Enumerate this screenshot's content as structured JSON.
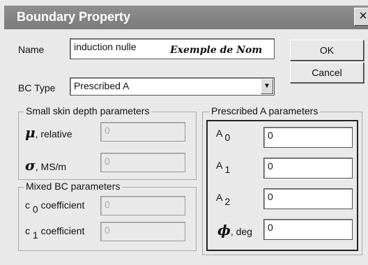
{
  "title": "Boundary Property",
  "name_field": {
    "label": "Name",
    "value": "induction nulle",
    "annotation": "Exemple de Nom"
  },
  "buttons": {
    "ok": "OK",
    "cancel": "Cancel"
  },
  "bc_type": {
    "label": "BC Type",
    "value": "Prescribed A"
  },
  "skin_depth": {
    "title": "Small skin depth parameters",
    "mu_symbol": "μ",
    "mu_label": ", relative",
    "mu_value": "0",
    "sigma_symbol": "σ",
    "sigma_label": ", MS/m",
    "sigma_value": "0"
  },
  "mixed": {
    "title": "Mixed BC parameters",
    "c0_base": "c",
    "c0_sub": "0",
    "c0_label": "coefficient",
    "c0_value": "0",
    "c1_base": "c",
    "c1_sub": "1",
    "c1_label": "coefficient",
    "c1_value": "0"
  },
  "prescribed": {
    "title": "Prescribed A parameters",
    "a0_base": "A",
    "a0_sub": "0",
    "a0_value": "0",
    "a1_base": "A",
    "a1_sub": "1",
    "a1_value": "0",
    "a2_base": "A",
    "a2_sub": "2",
    "a2_value": "0",
    "phi_symbol": "ϕ",
    "phi_label": ", deg",
    "phi_value": "0"
  }
}
